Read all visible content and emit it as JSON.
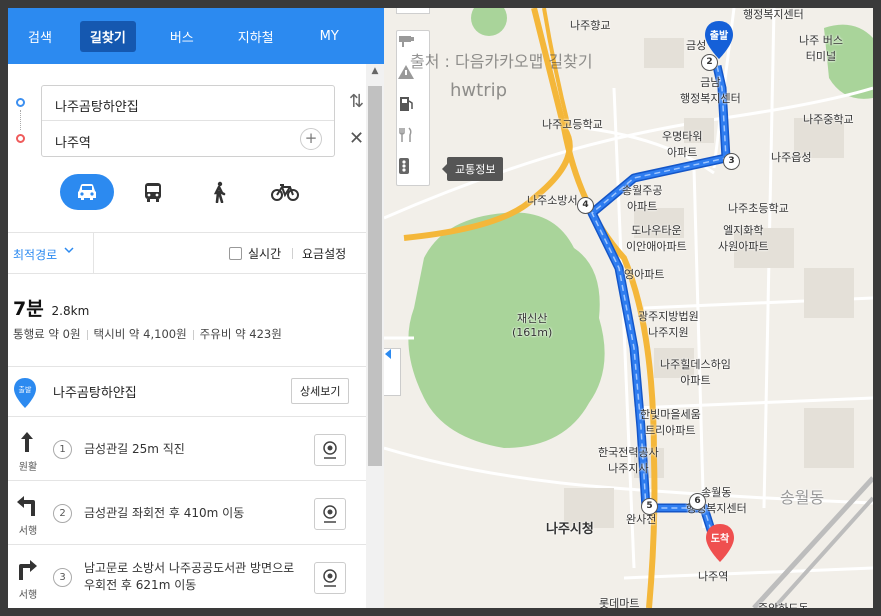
{
  "nav": {
    "tabs": [
      {
        "label": "검색"
      },
      {
        "label": "길찾기"
      },
      {
        "label": "버스"
      },
      {
        "label": "지하철"
      },
      {
        "label": "MY"
      }
    ],
    "active_tab": "길찾기"
  },
  "route_inputs": {
    "start": "나주곰탕하얀집",
    "end": "나주역"
  },
  "travel_modes": {
    "items": [
      "car",
      "bus",
      "walk",
      "bicycle"
    ],
    "active": "car"
  },
  "options": {
    "route_type": "최적경로",
    "realtime_label": "실시간",
    "realtime_checked": false,
    "fare_setting_label": "요금설정"
  },
  "summary": {
    "duration": "7분",
    "distance": "2.8km",
    "toll": "통행료 약 0원",
    "taxi": "택시비 약 4,100원",
    "fuel": "주유비 약 423원"
  },
  "start_point": {
    "badge": "출발",
    "name": "나주곰탕하얀집",
    "detail_button": "상세보기"
  },
  "steps": [
    {
      "num": "1",
      "direction": "원활",
      "text": "금성관길 25m 직진",
      "arrow": "straight"
    },
    {
      "num": "2",
      "direction": "서행",
      "text": "금성관길 좌회전 후 410m 이동",
      "arrow": "left"
    },
    {
      "num": "3",
      "direction": "서행",
      "text": "남고문로 소방서 나주공공도서관 방면으로 우회전 후 621m 이동",
      "arrow": "right"
    }
  ],
  "map": {
    "traffic_tooltip": "교통정보",
    "source_text": "출처 : 다음카카오맵 길찾기",
    "watermark": "hwtrip",
    "start_marker": "출발",
    "end_marker": "도착",
    "route_color": "#2f7df0",
    "park_color": "#a9d49a",
    "labels": {
      "hyanggyo": "나주향교",
      "geumseong": "금성",
      "geumnam_1": "금남",
      "geumnam_2": "행정복지센터",
      "haengjeong_top": "행정복지센터",
      "bus_terminal_1": "나주 버스",
      "bus_terminal_2": "터미널",
      "highschool": "나주고등학교",
      "woomyung_1": "우명타워",
      "woomyung_2": "아파트",
      "middleschool": "나주중학교",
      "naju_eup": "나주읍성",
      "firestation": "나주소방서",
      "songwoljugong_1": "송월주공",
      "songwoljugong_2": "아파트",
      "elementary": "나주초등학교",
      "donau_1": "도나우타운",
      "donau_2": "이안애아파트",
      "yelji_1": "엘지화학",
      "yelji_2": "사원아파트",
      "youngapt": "영아파트",
      "jaesinsan_1": "재신산",
      "jaesinsan_2": "(161m)",
      "court_1": "광주지방법원",
      "court_2": "나주지원",
      "hillstate_1": "나주힐데스하임",
      "hillstate_2": "아파트",
      "hanbit_1": "한빛마을세움",
      "hanbit_2": "트리아파트",
      "kepco_1": "한국전력공사",
      "kepco_2": "나주지사",
      "songwoldong_1": "송월동",
      "songwoldong_2": "행정복지센터",
      "songwoldong_big": "송월동",
      "cityhall": "나주시청",
      "wansa": "완사천",
      "najustation": "나주역",
      "lottemart": "롯데마트",
      "bottom_right": "중앙하도동"
    },
    "waypoints": [
      "2",
      "3",
      "4",
      "5",
      "6"
    ]
  }
}
